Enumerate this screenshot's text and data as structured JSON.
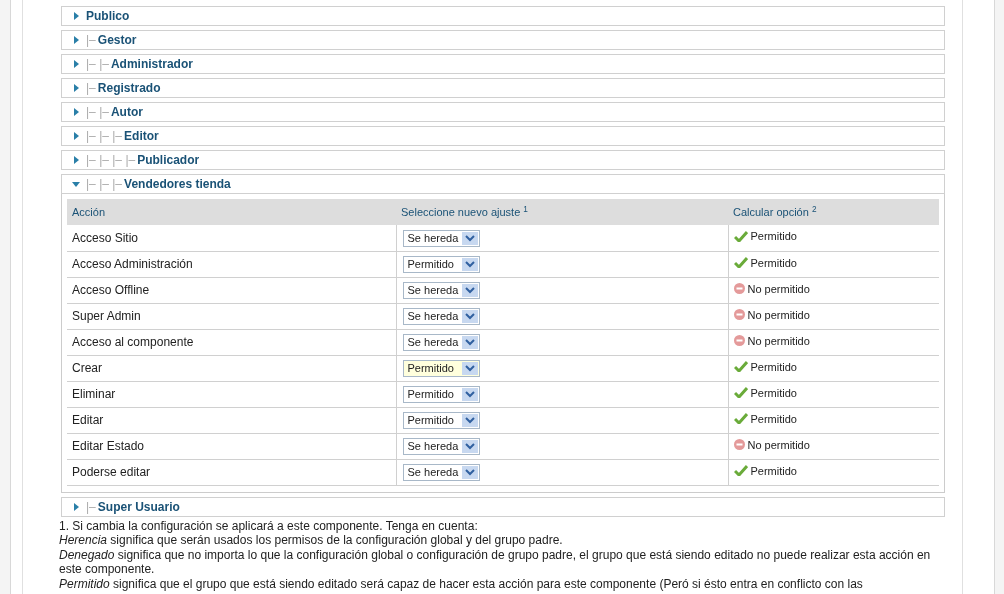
{
  "groups_before": [
    {
      "label": "Publico",
      "expanded": false
    },
    {
      "prefix": "|–",
      "label": "Gestor",
      "expanded": false
    },
    {
      "prefix": "|– |–",
      "label": "Administrador",
      "expanded": false
    },
    {
      "prefix": "|–",
      "label": "Registrado",
      "expanded": false
    },
    {
      "prefix": "|– |–",
      "label": "Autor",
      "expanded": false
    },
    {
      "prefix": "|– |– |–",
      "label": "Editor",
      "expanded": false
    },
    {
      "prefix": "|– |– |– |–",
      "label": "Publicador",
      "expanded": false
    },
    {
      "prefix": "|– |– |–",
      "label": "Vendedores tienda",
      "expanded": true
    }
  ],
  "table": {
    "columns": [
      "Acción",
      "Seleccione nuevo ajuste $^{1}$",
      "Calcular opción $^{2}$"
    ],
    "rows": [
      {
        "action": "Acceso Sitio",
        "setting": "Se hereda",
        "highlighted": false,
        "allowed": true,
        "result": "Permitido"
      },
      {
        "action": "Acceso Administración",
        "setting": "Permitido",
        "highlighted": false,
        "allowed": true,
        "result": "Permitido"
      },
      {
        "action": "Acceso Offline",
        "setting": "Se hereda",
        "highlighted": false,
        "allowed": false,
        "result": "No permitido"
      },
      {
        "action": "Super Admin",
        "setting": "Se hereda",
        "highlighted": false,
        "allowed": false,
        "result": "No permitido"
      },
      {
        "action": "Acceso al componente",
        "setting": "Se hereda",
        "highlighted": false,
        "allowed": false,
        "result": "No permitido"
      },
      {
        "action": "Crear",
        "setting": "Permitido",
        "highlighted": true,
        "allowed": true,
        "result": "Permitido"
      },
      {
        "action": "Eliminar",
        "setting": "Permitido",
        "highlighted": false,
        "allowed": true,
        "result": "Permitido"
      },
      {
        "action": "Editar",
        "setting": "Permitido",
        "highlighted": false,
        "allowed": true,
        "result": "Permitido"
      },
      {
        "action": "Editar Estado",
        "setting": "Se hereda",
        "highlighted": false,
        "allowed": false,
        "result": "No permitido"
      },
      {
        "action": "Poderse editar",
        "setting": "Se hereda",
        "highlighted": false,
        "allowed": true,
        "result": "Permitido"
      }
    ]
  },
  "groups_after": [
    {
      "prefix": "|–",
      "label": "Super Usuario",
      "expanded": false
    }
  ],
  "notes": [
    "1. Si cambia la configuración se aplicará a este componente. Tenga en cuenta:",
    "*Herencia* significa que serán usados los permisos de la configuración global y del grupo padre.",
    "*Denegado* significa que no importa lo que la configuración global o configuración de grupo padre, el grupo que está siendo editado no puede realizar esta acción en este componente.",
    "*Permitido* significa que el grupo que está siendo editado será capaz de hacer esta acción para este componente (Peró si ésto entra en conflicto con las"
  ]
}
